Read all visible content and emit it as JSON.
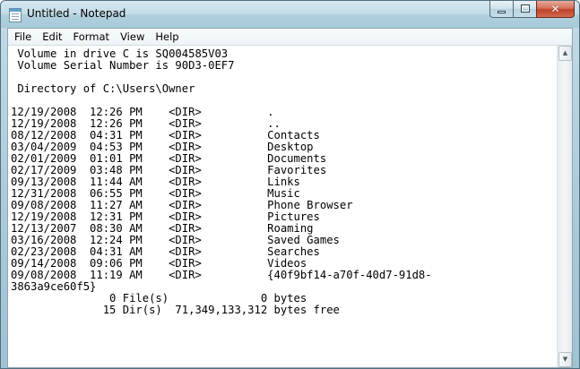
{
  "window": {
    "title": "Untitled - Notepad",
    "controls": {
      "minimize": "",
      "maximize": "",
      "close": "✕"
    }
  },
  "menu": [
    "File",
    "Edit",
    "Format",
    "View",
    "Help"
  ],
  "document": {
    "lines": [
      " Volume in drive C is SQ004585V03",
      " Volume Serial Number is 90D3-0EF7",
      "",
      " Directory of C:\\Users\\Owner",
      "",
      "12/19/2008  12:26 PM    <DIR>          .",
      "12/19/2008  12:26 PM    <DIR>          ..",
      "08/12/2008  04:31 PM    <DIR>          Contacts",
      "03/04/2009  04:53 PM    <DIR>          Desktop",
      "02/01/2009  01:01 PM    <DIR>          Documents",
      "02/17/2009  03:48 PM    <DIR>          Favorites",
      "09/13/2008  11:44 AM    <DIR>          Links",
      "12/31/2008  06:55 PM    <DIR>          Music",
      "09/08/2008  11:27 AM    <DIR>          Phone Browser",
      "12/19/2008  12:31 PM    <DIR>          Pictures",
      "12/13/2007  08:30 AM    <DIR>          Roaming",
      "03/16/2008  12:24 PM    <DIR>          Saved Games",
      "02/23/2008  04:31 AM    <DIR>          Searches",
      "09/14/2008  09:06 PM    <DIR>          Videos",
      "09/08/2008  11:19 AM    <DIR>          {40f9bf14-a70f-40d7-91d8-",
      "3863a9ce60f5}",
      "               0 File(s)              0 bytes",
      "              15 Dir(s)  71,349,133,312 bytes free"
    ]
  },
  "scrollbar": {
    "up": "▲",
    "down": "▼"
  }
}
